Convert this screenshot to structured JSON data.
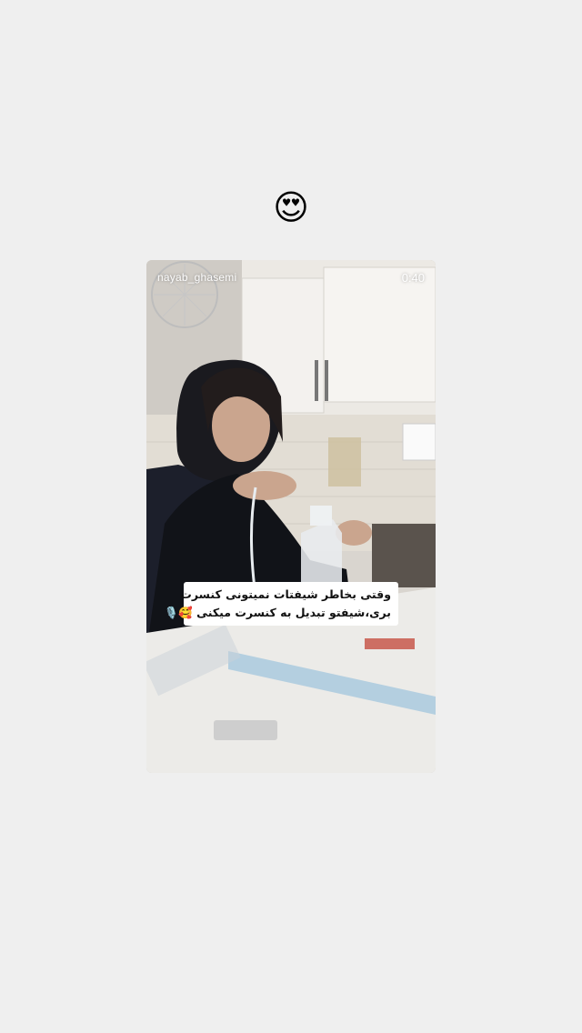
{
  "reaction": {
    "emoji": "😍",
    "icon": "heart-eyes-emoji-icon"
  },
  "story": {
    "username": "nayab_ghasemi",
    "duration": "0:40",
    "caption_line_1": "وقتی بخاطر شیفتات نمیتونی کنسرت",
    "caption_line_2": "بری،شیفتو تبدیل به کنسرت میکنی 🥰🎙️"
  },
  "colors": {
    "page_background": "#efefef",
    "caption_background": "#ffffff",
    "caption_text": "#111111"
  }
}
